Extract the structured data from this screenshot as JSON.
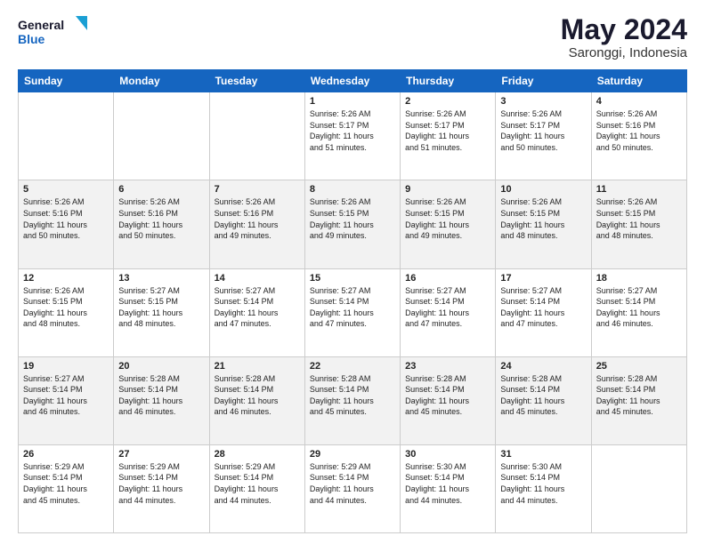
{
  "logo": {
    "line1": "General",
    "line2": "Blue"
  },
  "title": "May 2024",
  "subtitle": "Saronggi, Indonesia",
  "days_header": [
    "Sunday",
    "Monday",
    "Tuesday",
    "Wednesday",
    "Thursday",
    "Friday",
    "Saturday"
  ],
  "weeks": [
    [
      {
        "day": "",
        "info": ""
      },
      {
        "day": "",
        "info": ""
      },
      {
        "day": "",
        "info": ""
      },
      {
        "day": "1",
        "info": "Sunrise: 5:26 AM\nSunset: 5:17 PM\nDaylight: 11 hours\nand 51 minutes."
      },
      {
        "day": "2",
        "info": "Sunrise: 5:26 AM\nSunset: 5:17 PM\nDaylight: 11 hours\nand 51 minutes."
      },
      {
        "day": "3",
        "info": "Sunrise: 5:26 AM\nSunset: 5:17 PM\nDaylight: 11 hours\nand 50 minutes."
      },
      {
        "day": "4",
        "info": "Sunrise: 5:26 AM\nSunset: 5:16 PM\nDaylight: 11 hours\nand 50 minutes."
      }
    ],
    [
      {
        "day": "5",
        "info": "Sunrise: 5:26 AM\nSunset: 5:16 PM\nDaylight: 11 hours\nand 50 minutes."
      },
      {
        "day": "6",
        "info": "Sunrise: 5:26 AM\nSunset: 5:16 PM\nDaylight: 11 hours\nand 50 minutes."
      },
      {
        "day": "7",
        "info": "Sunrise: 5:26 AM\nSunset: 5:16 PM\nDaylight: 11 hours\nand 49 minutes."
      },
      {
        "day": "8",
        "info": "Sunrise: 5:26 AM\nSunset: 5:15 PM\nDaylight: 11 hours\nand 49 minutes."
      },
      {
        "day": "9",
        "info": "Sunrise: 5:26 AM\nSunset: 5:15 PM\nDaylight: 11 hours\nand 49 minutes."
      },
      {
        "day": "10",
        "info": "Sunrise: 5:26 AM\nSunset: 5:15 PM\nDaylight: 11 hours\nand 48 minutes."
      },
      {
        "day": "11",
        "info": "Sunrise: 5:26 AM\nSunset: 5:15 PM\nDaylight: 11 hours\nand 48 minutes."
      }
    ],
    [
      {
        "day": "12",
        "info": "Sunrise: 5:26 AM\nSunset: 5:15 PM\nDaylight: 11 hours\nand 48 minutes."
      },
      {
        "day": "13",
        "info": "Sunrise: 5:27 AM\nSunset: 5:15 PM\nDaylight: 11 hours\nand 48 minutes."
      },
      {
        "day": "14",
        "info": "Sunrise: 5:27 AM\nSunset: 5:14 PM\nDaylight: 11 hours\nand 47 minutes."
      },
      {
        "day": "15",
        "info": "Sunrise: 5:27 AM\nSunset: 5:14 PM\nDaylight: 11 hours\nand 47 minutes."
      },
      {
        "day": "16",
        "info": "Sunrise: 5:27 AM\nSunset: 5:14 PM\nDaylight: 11 hours\nand 47 minutes."
      },
      {
        "day": "17",
        "info": "Sunrise: 5:27 AM\nSunset: 5:14 PM\nDaylight: 11 hours\nand 47 minutes."
      },
      {
        "day": "18",
        "info": "Sunrise: 5:27 AM\nSunset: 5:14 PM\nDaylight: 11 hours\nand 46 minutes."
      }
    ],
    [
      {
        "day": "19",
        "info": "Sunrise: 5:27 AM\nSunset: 5:14 PM\nDaylight: 11 hours\nand 46 minutes."
      },
      {
        "day": "20",
        "info": "Sunrise: 5:28 AM\nSunset: 5:14 PM\nDaylight: 11 hours\nand 46 minutes."
      },
      {
        "day": "21",
        "info": "Sunrise: 5:28 AM\nSunset: 5:14 PM\nDaylight: 11 hours\nand 46 minutes."
      },
      {
        "day": "22",
        "info": "Sunrise: 5:28 AM\nSunset: 5:14 PM\nDaylight: 11 hours\nand 45 minutes."
      },
      {
        "day": "23",
        "info": "Sunrise: 5:28 AM\nSunset: 5:14 PM\nDaylight: 11 hours\nand 45 minutes."
      },
      {
        "day": "24",
        "info": "Sunrise: 5:28 AM\nSunset: 5:14 PM\nDaylight: 11 hours\nand 45 minutes."
      },
      {
        "day": "25",
        "info": "Sunrise: 5:28 AM\nSunset: 5:14 PM\nDaylight: 11 hours\nand 45 minutes."
      }
    ],
    [
      {
        "day": "26",
        "info": "Sunrise: 5:29 AM\nSunset: 5:14 PM\nDaylight: 11 hours\nand 45 minutes."
      },
      {
        "day": "27",
        "info": "Sunrise: 5:29 AM\nSunset: 5:14 PM\nDaylight: 11 hours\nand 44 minutes."
      },
      {
        "day": "28",
        "info": "Sunrise: 5:29 AM\nSunset: 5:14 PM\nDaylight: 11 hours\nand 44 minutes."
      },
      {
        "day": "29",
        "info": "Sunrise: 5:29 AM\nSunset: 5:14 PM\nDaylight: 11 hours\nand 44 minutes."
      },
      {
        "day": "30",
        "info": "Sunrise: 5:30 AM\nSunset: 5:14 PM\nDaylight: 11 hours\nand 44 minutes."
      },
      {
        "day": "31",
        "info": "Sunrise: 5:30 AM\nSunset: 5:14 PM\nDaylight: 11 hours\nand 44 minutes."
      },
      {
        "day": "",
        "info": ""
      }
    ]
  ]
}
